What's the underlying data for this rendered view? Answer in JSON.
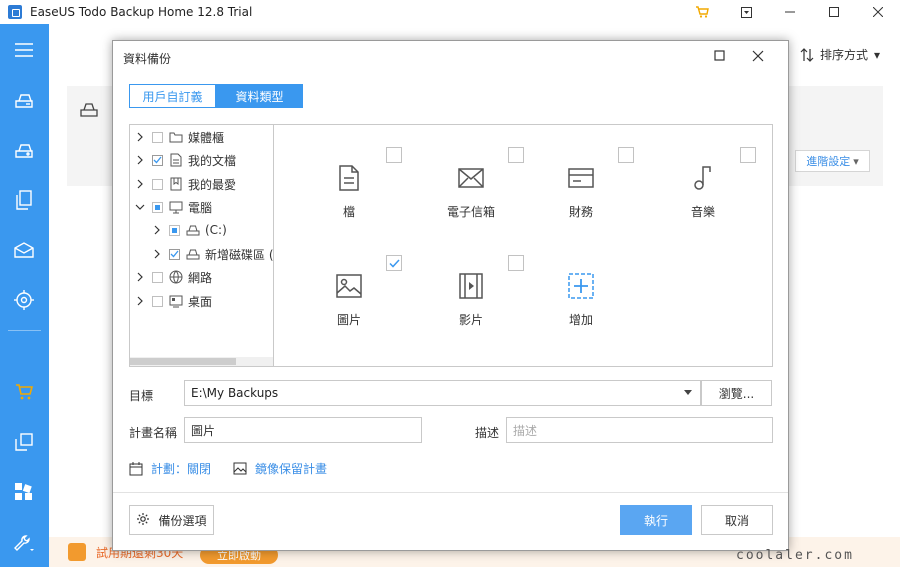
{
  "app": {
    "title": "EaseUS Todo Backup Home 12.8 Trial"
  },
  "main": {
    "sort_label": "排序方式",
    "advanced_label": "進階設定",
    "trial_text": "試用期還剩30天",
    "buy_label": "立即啟動"
  },
  "dialog": {
    "title": "資料備份",
    "tabs": [
      {
        "label": "用戶自訂義",
        "active": false
      },
      {
        "label": "資料類型",
        "active": true
      }
    ],
    "tree": [
      {
        "label": "媒體櫃",
        "expanded": false,
        "state": "unchecked",
        "icon": "folder-icon"
      },
      {
        "label": "我的文檔",
        "expanded": false,
        "state": "checked",
        "icon": "document-icon"
      },
      {
        "label": "我的最愛",
        "expanded": false,
        "state": "unchecked",
        "icon": "favorites-icon"
      },
      {
        "label": "電腦",
        "expanded": true,
        "state": "partial",
        "icon": "computer-icon"
      },
      {
        "label": "(C:)",
        "expanded": false,
        "state": "partial",
        "icon": "drive-icon"
      },
      {
        "label": "新增磁碟區 (D",
        "expanded": false,
        "state": "checked",
        "icon": "drive-icon"
      },
      {
        "label": "網路",
        "expanded": false,
        "state": "unchecked",
        "icon": "network-icon"
      },
      {
        "label": "桌面",
        "expanded": false,
        "state": "unchecked",
        "icon": "desktop-icon"
      }
    ],
    "categories": [
      {
        "label": "檔",
        "icon": "file-icon",
        "checked": false
      },
      {
        "label": "電子信箱",
        "icon": "mail-icon",
        "checked": false
      },
      {
        "label": "財務",
        "icon": "finance-icon",
        "checked": false
      },
      {
        "label": "音樂",
        "icon": "music-icon",
        "checked": false
      },
      {
        "label": "圖片",
        "icon": "image-icon",
        "checked": true
      },
      {
        "label": "影片",
        "icon": "video-icon",
        "checked": false
      },
      {
        "label": "增加",
        "icon": "add-icon",
        "checked": false
      }
    ],
    "target_label": "目標",
    "target_value": "E:\\My Backups",
    "browse_label": "瀏覽...",
    "plan_name_label": "計畫名稱",
    "plan_name_value": "圖片",
    "desc_label": "描述",
    "desc_placeholder": "描述",
    "schedule_label": "計劃：關閉",
    "image_reserve_label": "鏡像保留計畫",
    "options_label": "備份選項",
    "run_label": "執行",
    "cancel_label": "取消"
  },
  "watermark": "coolaler.com",
  "colors": {
    "accent": "#3a98ef",
    "sidebar": "#3a98ef",
    "primary_button": "#5aa6f2",
    "trial": "#e96b2a"
  }
}
